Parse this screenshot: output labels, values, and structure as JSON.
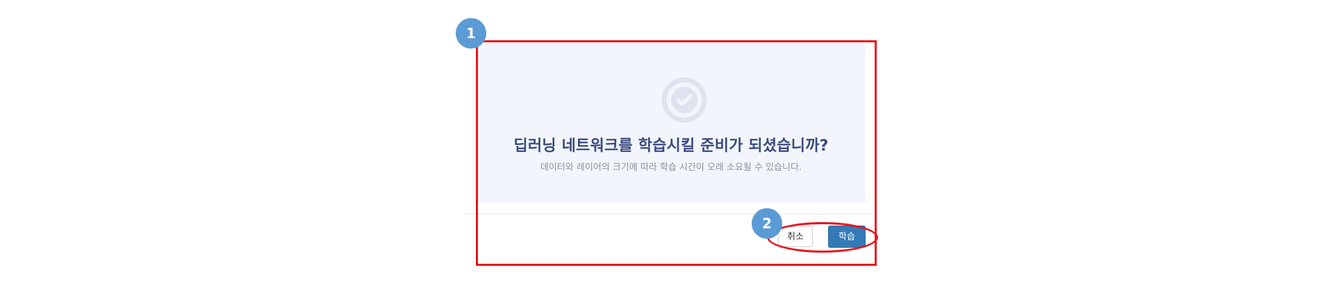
{
  "dialog": {
    "title": "딥러닝 네트워크를 학습시킬 준비가 되셨습니까?",
    "subtitle": "데이터와 레이어의 크기에 따라 학습 시간이 오래 소요될 수 있습니다.",
    "icon": "check-circle-icon",
    "cancel_label": "취소",
    "train_label": "학습"
  },
  "annotations": {
    "badge_1": "1",
    "badge_2": "2",
    "highlight_color": "#e8141c",
    "badge_color": "#5b9bd5"
  },
  "colors": {
    "title": "#3a4a7e",
    "panel_background": "#f2f5fc",
    "primary_button": "#337ab7"
  }
}
